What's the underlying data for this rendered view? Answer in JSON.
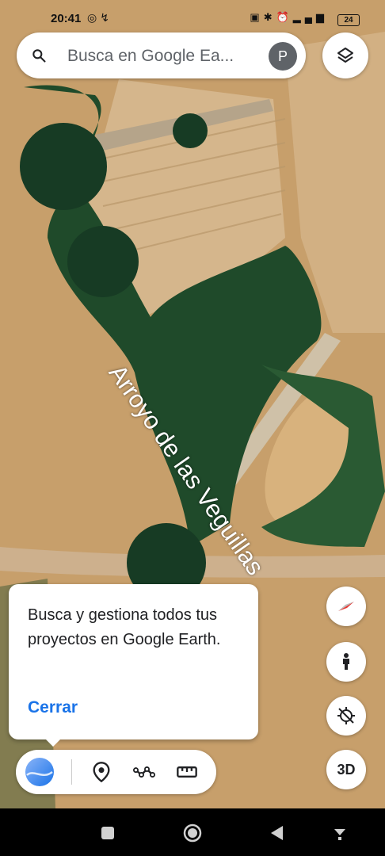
{
  "status_bar": {
    "time": "20:41",
    "left_icons": [
      "whatsapp-icon",
      "missed-call-icon"
    ],
    "right_icons": [
      "nfc-icon",
      "bluetooth-icon",
      "alarm-icon",
      "signal-icon",
      "wifi-icon"
    ],
    "battery": "24"
  },
  "search": {
    "placeholder": "Busca en Google Ea...",
    "avatar_letter": "P"
  },
  "map": {
    "place_label": "Arroyo de las Veguillas"
  },
  "popup": {
    "message": "Busca y gestiona todos tus proyectos en Google Earth.",
    "close_label": "Cerrar"
  },
  "controls": {
    "three_d_label": "3D"
  },
  "toolbar": {
    "items": [
      "earth-icon",
      "place-marker-icon",
      "path-icon",
      "measure-icon"
    ]
  },
  "navbar": {
    "items": [
      "recents-icon",
      "home-icon",
      "back-icon",
      "keyboard-hide-icon"
    ]
  },
  "colors": {
    "accent": "#1a73e8",
    "field": "#c9a36f",
    "vegetation": "#1f4a2a"
  }
}
